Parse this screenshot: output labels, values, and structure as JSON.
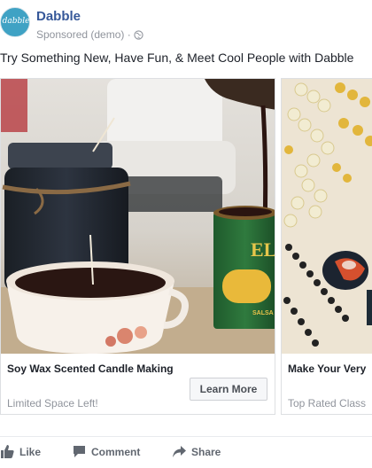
{
  "post": {
    "page_name": "Dabble",
    "avatar_text": "dabble",
    "sponsored_label": "Sponsored (demo) ·",
    "message": "Try Something New, Have Fun, & Meet Cool People with Dabble"
  },
  "carousel": {
    "cards": [
      {
        "title": "Soy Wax Scented Candle Making",
        "description": "Limited Space Left!",
        "cta": "Learn More",
        "image_subject": "candle-making",
        "tin_label": "EL",
        "tin_sublabel": "SALSA"
      },
      {
        "title": "Make Your Very",
        "description": "Top Rated Class",
        "image_subject": "beaded-jewelry"
      }
    ]
  },
  "actions": {
    "like": "Like",
    "comment": "Comment",
    "share": "Share"
  },
  "colors": {
    "link": "#365899",
    "meta": "#90949c",
    "avatar": "#3fa2c4",
    "action": "#616770"
  },
  "icons": [
    "globe-icon",
    "like-icon",
    "comment-icon",
    "share-icon"
  ]
}
